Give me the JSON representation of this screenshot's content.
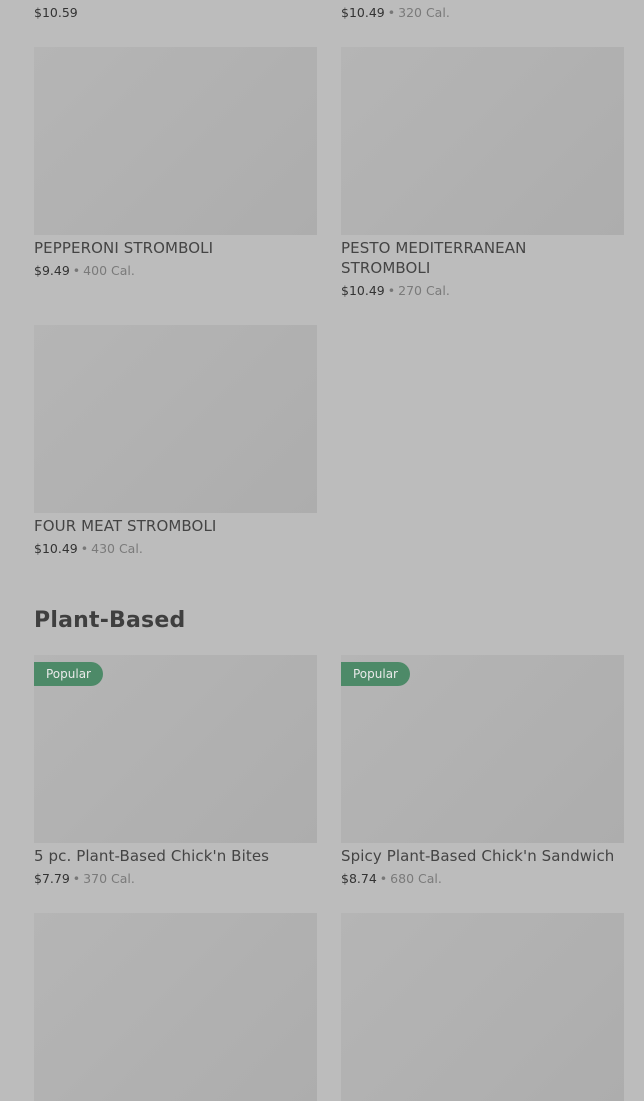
{
  "top_row": {
    "left": {
      "price": "$10.59"
    },
    "right": {
      "price": "$10.49",
      "calories": "320 Cal."
    }
  },
  "stromboli": [
    {
      "name": "PEPPERONI STROMBOLI",
      "price": "$9.49",
      "calories": "400 Cal."
    },
    {
      "name": "PESTO MEDITERRANEAN STROMBOLI",
      "price": "$10.49",
      "calories": "270 Cal."
    },
    {
      "name": "FOUR MEAT STROMBOLI",
      "price": "$10.49",
      "calories": "430 Cal."
    }
  ],
  "plant_based": {
    "title": "Plant-Based",
    "items": [
      {
        "badge": "Popular",
        "name": "5 pc. Plant-Based Chick'n Bites",
        "price": "$7.79",
        "calories": "370 Cal."
      },
      {
        "badge": "Popular",
        "name": "Spicy Plant-Based Chick'n Sandwich",
        "price": "$8.74",
        "calories": "680 Cal."
      }
    ]
  },
  "separator": "•",
  "colors": {
    "badge": "#4d8a68",
    "overlay": "#bcbcbc"
  }
}
